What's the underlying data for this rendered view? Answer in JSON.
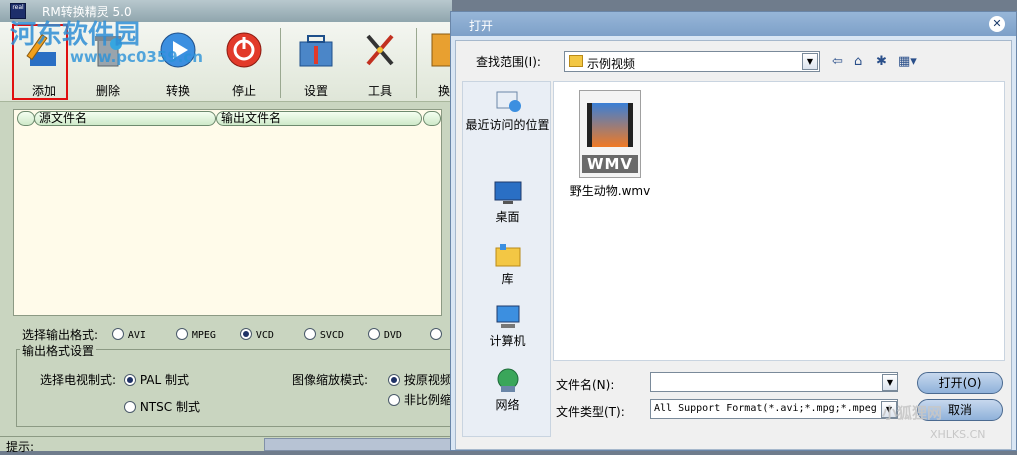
{
  "app": {
    "title": "RM转换精灵 5.0",
    "icon_text": "real",
    "watermark": "河东软件园",
    "watermark_url": "www.pc0359.cn",
    "toolbar": [
      {
        "key": "add",
        "label": "添加",
        "icon": "add-pencil-icon"
      },
      {
        "key": "delete",
        "label": "删除",
        "icon": "trash-icon"
      },
      {
        "key": "convert",
        "label": "转换",
        "icon": "play-icon"
      },
      {
        "key": "stop",
        "label": "停止",
        "icon": "power-stop-icon"
      },
      {
        "key": "settings",
        "label": "设置",
        "icon": "toolbox-icon"
      },
      {
        "key": "tools",
        "label": "工具",
        "icon": "scissors-icon"
      },
      {
        "key": "more",
        "label": "换",
        "icon": "more-icon"
      }
    ],
    "file_list": {
      "col_source": "源文件名",
      "col_output": "输出文件名"
    },
    "output_format": {
      "label": "选择输出格式:",
      "options": [
        "AVI",
        "MPEG",
        "VCD",
        "SVCD",
        "DVD"
      ],
      "selected": "VCD"
    },
    "format_settings": {
      "group_title": "输出格式设置",
      "tv_label": "选择电视制式:",
      "tv_options": [
        "PAL 制式",
        "NTSC 制式"
      ],
      "tv_selected": "PAL 制式",
      "scale_label": "图像缩放模式:",
      "scale_options": [
        "按原视频",
        "非比例缩"
      ]
    },
    "status_label": "提示:",
    "accent": "#e01010"
  },
  "dialog": {
    "title": "打开",
    "close_glyph": "✕",
    "lookin_label": "查找范围(I):",
    "lookin_value": "示例视频",
    "places": [
      {
        "label": "最近访问的位置",
        "icon": "recent-places-icon"
      },
      {
        "label": "桌面",
        "icon": "desktop-icon"
      },
      {
        "label": "库",
        "icon": "library-icon"
      },
      {
        "label": "计算机",
        "icon": "computer-icon"
      },
      {
        "label": "网络",
        "icon": "network-icon"
      }
    ],
    "file": {
      "name": "野生动物.wmv",
      "badge": "WMV"
    },
    "filename_label": "文件名(N):",
    "filename_value": "",
    "filetype_label": "文件类型(T):",
    "filetype_value": "All Support Format(*.avi;*.mpg;*.mpeg",
    "open_button": "打开(O)",
    "cancel_button": "取消"
  },
  "brand": {
    "text": "小狐狸网",
    "url": "XHLKS.CN"
  }
}
